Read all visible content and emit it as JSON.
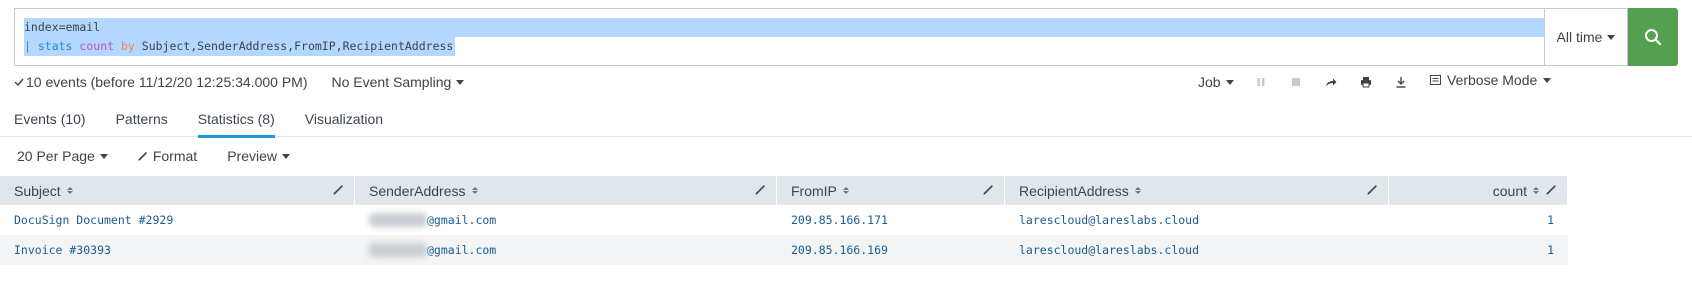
{
  "search": {
    "line1": "index=email",
    "line2_pipe": "| ",
    "line2_cmd": "stats",
    "line2_fn": "count",
    "line2_by": "by",
    "line2_fields": "Subject,SenderAddress,FromIP,RecipientAddress",
    "time_range": "All time"
  },
  "status": {
    "events_text": "10 events (before 11/12/20 12:25:34.000 PM)",
    "sampling": "No Event Sampling",
    "job_label": "Job",
    "mode_label": "Verbose Mode"
  },
  "tabs": [
    {
      "label": "Events (10)"
    },
    {
      "label": "Patterns"
    },
    {
      "label": "Statistics (8)"
    },
    {
      "label": "Visualization"
    }
  ],
  "controls": {
    "per_page": "20 Per Page",
    "format": "Format",
    "preview": "Preview"
  },
  "table": {
    "headers": [
      "Subject",
      "SenderAddress",
      "FromIP",
      "RecipientAddress",
      "count"
    ],
    "rows": [
      {
        "subject": "DocuSign Document #2929",
        "sender_suffix": "@gmail.com",
        "from_ip": "209.85.166.171",
        "recipient": "larescloud@lareslabs.cloud",
        "count": "1"
      },
      {
        "subject": "Invoice #30393",
        "sender_suffix": "@gmail.com",
        "from_ip": "209.85.166.169",
        "recipient": "larescloud@lareslabs.cloud",
        "count": "1"
      }
    ]
  },
  "colors": {
    "search_button": "#53a051",
    "tab_active_underline": "#1a9be0",
    "selection": "#b4d7ff",
    "table_header": "#e1e6eb",
    "link_text": "#1a5c8f"
  }
}
